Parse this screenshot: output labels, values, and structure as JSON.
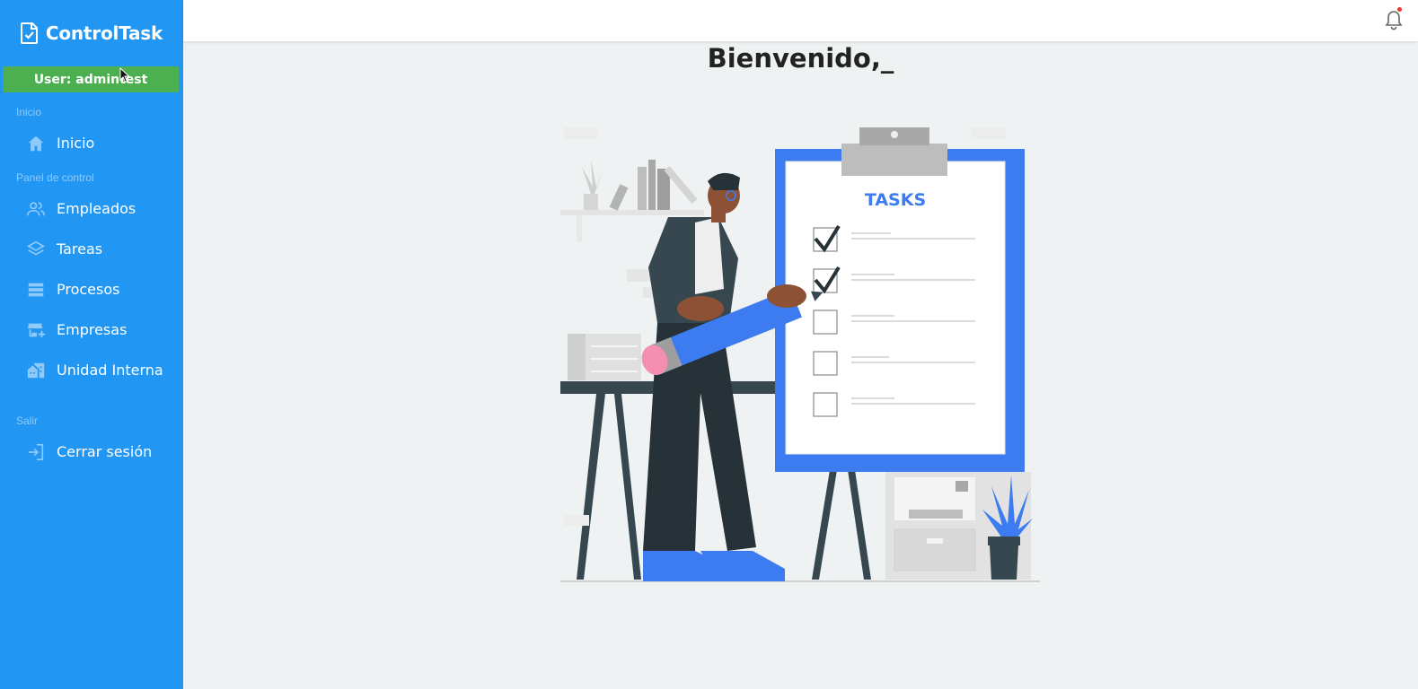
{
  "app": {
    "title": "ControlTask"
  },
  "user_badge": "User: admintest",
  "sidebar": {
    "sections": [
      {
        "label": "Inicio"
      },
      {
        "label": "Panel de control"
      },
      {
        "label": "Salir"
      }
    ],
    "items": [
      {
        "label": "Inicio",
        "icon": "home-icon"
      },
      {
        "label": "Empleados",
        "icon": "people-icon"
      },
      {
        "label": "Tareas",
        "icon": "layers-icon"
      },
      {
        "label": "Procesos",
        "icon": "list-icon"
      },
      {
        "label": "Empresas",
        "icon": "store-add-icon"
      },
      {
        "label": "Unidad Interna",
        "icon": "buildings-icon"
      },
      {
        "label": "Cerrar sesión",
        "icon": "logout-icon"
      }
    ]
  },
  "main": {
    "welcome": "Bienvenido,_",
    "illustration_text": "TASKS"
  },
  "colors": {
    "sidebar": "#2196f3",
    "user_badge": "#4caf50",
    "background": "#eef2f2",
    "accent_blue": "#3d7bf0"
  }
}
